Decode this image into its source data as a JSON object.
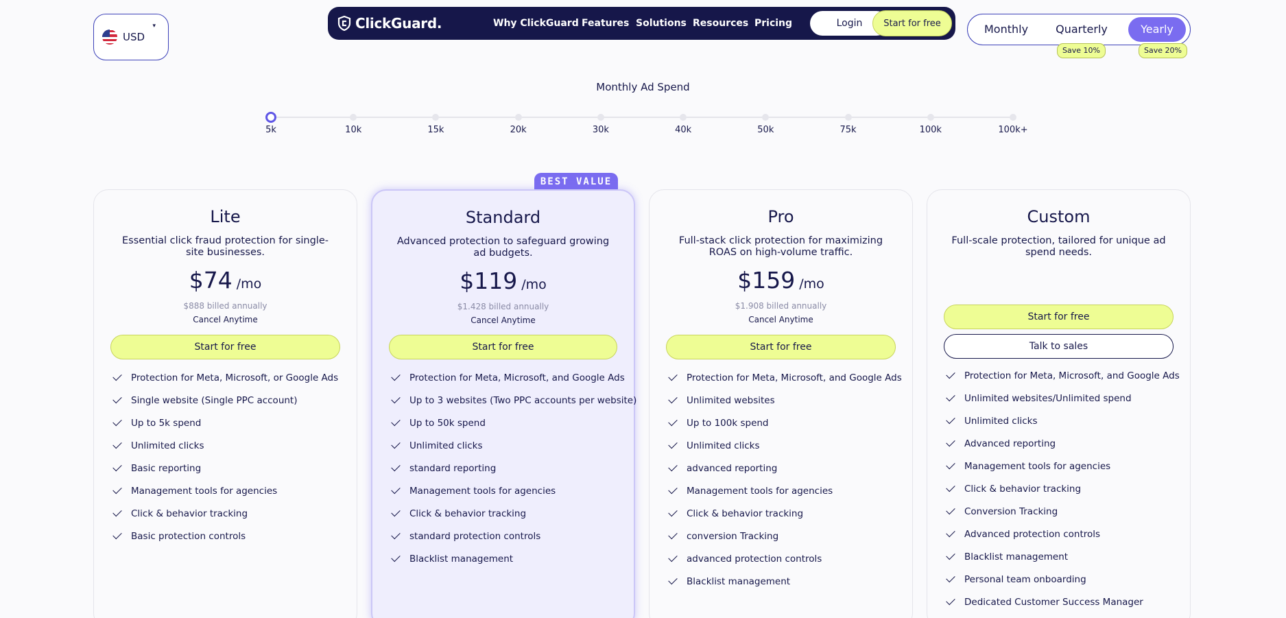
{
  "currency": {
    "code": "USD",
    "caret": "▾"
  },
  "nav": {
    "logo": "ClickGuard.",
    "links": [
      "Why ClickGuard",
      "Features",
      "Solutions",
      "Resources",
      "Pricing"
    ],
    "login": "Login",
    "start": "Start for free"
  },
  "billing": {
    "options": [
      "Monthly",
      "Quarterly",
      "Yearly"
    ],
    "selected": "Yearly",
    "badges": [
      "Save 10%",
      "Save 20%"
    ]
  },
  "spend": {
    "label": "Monthly Ad Spend",
    "stops": [
      "5k",
      "10k",
      "15k",
      "20k",
      "30k",
      "40k",
      "50k",
      "75k",
      "100k",
      "100k+"
    ],
    "selected": "5k"
  },
  "best_value": "BEST VALUE",
  "plans": [
    {
      "name": "Lite",
      "description": "Essential click fraud protection for single-site businesses.",
      "price": "$74",
      "per": "/mo",
      "billed": "$888 billed annually",
      "cancel": "Cancel Anytime",
      "cta": "Start for free",
      "features": [
        "Protection for Meta, Microsoft, or Google Ads",
        "Single website (Single PPC account)",
        "Up to 5k spend",
        "Unlimited clicks",
        "Basic reporting",
        "Management tools for agencies",
        "Click & behavior tracking",
        "Basic protection controls"
      ]
    },
    {
      "name": "Standard",
      "description": "Advanced protection to safeguard growing ad budgets.",
      "price": "$119",
      "per": "/mo",
      "billed": "$1.428 billed annually",
      "cancel": "Cancel Anytime",
      "cta": "Start for free",
      "features": [
        "Protection for Meta, Microsoft, and Google Ads",
        "Up to 3 websites (Two PPC accounts per website)",
        "Up to 50k spend",
        "Unlimited clicks",
        "standard reporting",
        "Management tools for agencies",
        "Click & behavior tracking",
        "standard protection controls",
        "Blacklist management"
      ]
    },
    {
      "name": "Pro",
      "description": "Full-stack click protection for maximizing ROAS on high-volume traffic.",
      "price": "$159",
      "per": "/mo",
      "billed": "$1.908 billed annually",
      "cancel": "Cancel Anytime",
      "cta": "Start for free",
      "features": [
        "Protection for Meta, Microsoft, and Google Ads",
        "Unlimited websites",
        "Up to 100k spend",
        "Unlimited clicks",
        "advanced reporting",
        "Management tools for agencies",
        "Click & behavior tracking",
        "conversion Tracking",
        "advanced protection controls",
        "Blacklist management"
      ]
    },
    {
      "name": "Custom",
      "description": "Full-scale protection, tailored for unique ad spend needs.",
      "cta": "Start for free",
      "cta_secondary": "Talk to sales",
      "features": [
        "Protection for Meta, Microsoft, and Google Ads",
        "Unlimited websites/Unlimited spend",
        "Unlimited clicks",
        "Advanced reporting",
        "Management tools for agencies",
        "Click & behavior tracking",
        "Conversion Tracking",
        "Advanced protection controls",
        "Blacklist management",
        "Personal team onboarding",
        "Dedicated Customer Success Manager"
      ]
    }
  ],
  "colors": {
    "navy": "#16174a",
    "accent": "#7a6cf0",
    "lime": "#eefd94"
  }
}
